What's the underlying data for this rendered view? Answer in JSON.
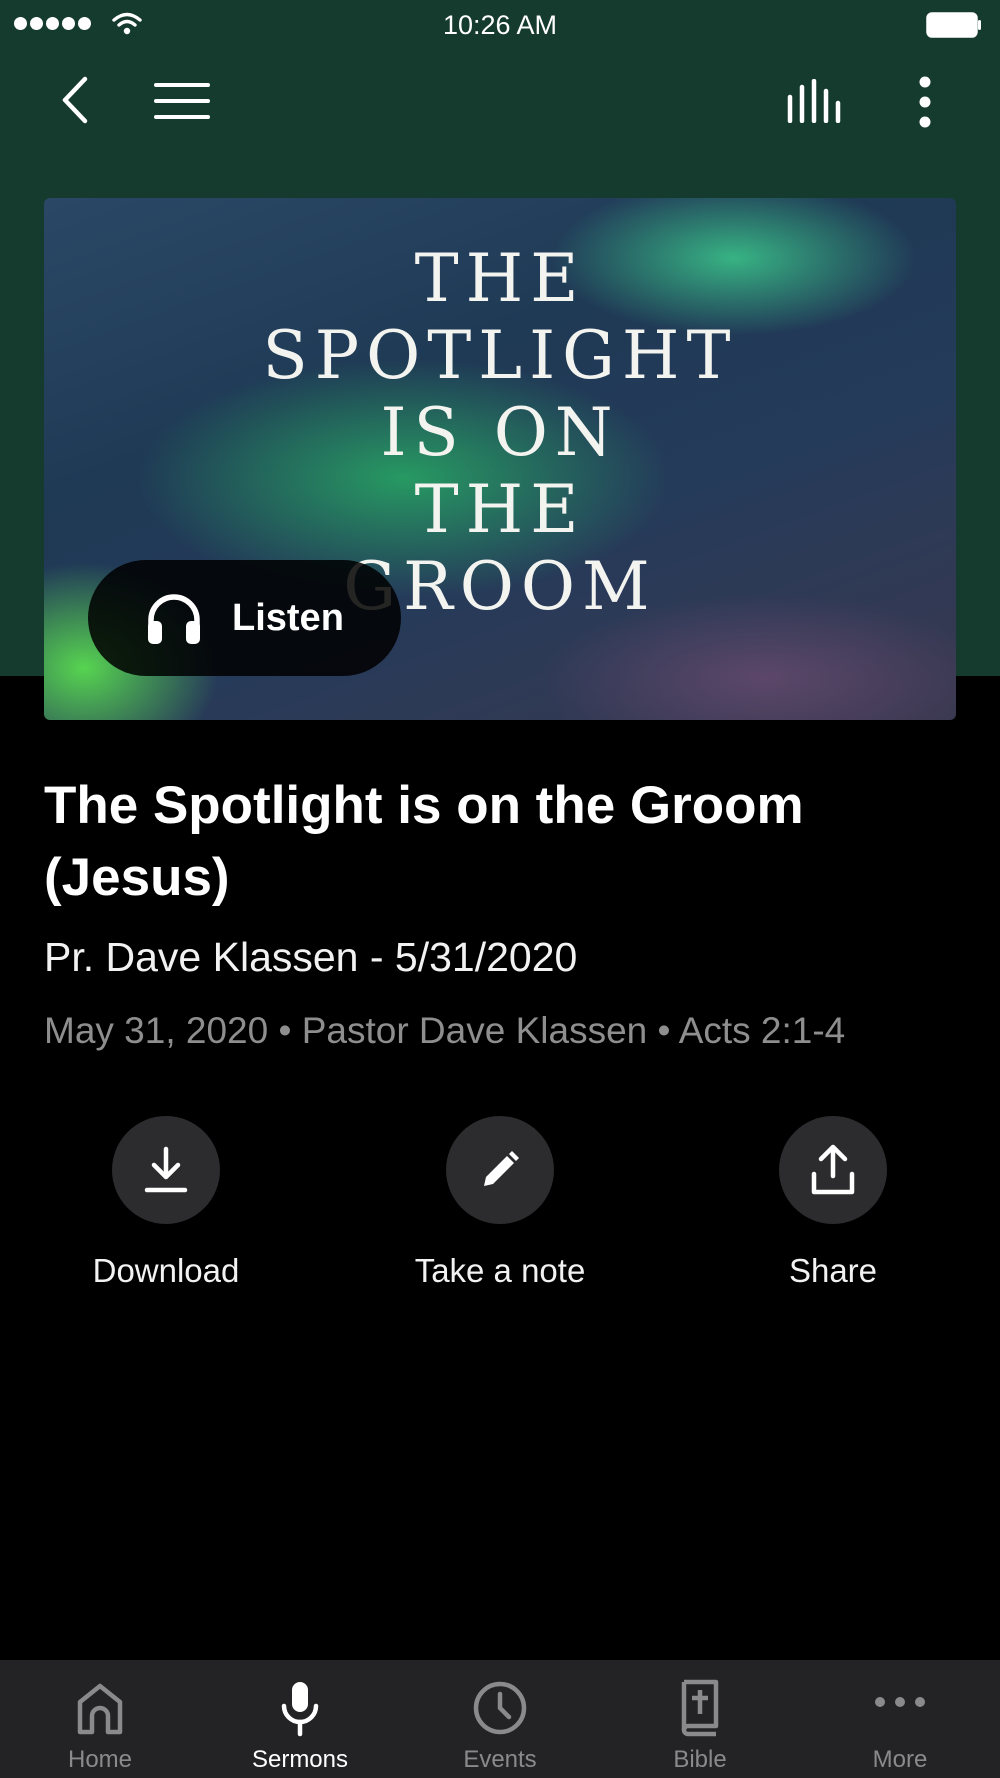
{
  "status_bar": {
    "time": "10:26 AM"
  },
  "nav": {
    "back": "back-icon",
    "menu": "menu-icon",
    "audio": "audio-bars-icon",
    "more": "more-vertical-icon"
  },
  "artwork": {
    "title": "THE\nSPOTLIGHT\nIS ON\nTHE\nGROOM"
  },
  "listen_button": {
    "label": "Listen",
    "icon": "headphones-icon"
  },
  "sermon": {
    "title": "The Spotlight is on the Groom (Jesus)",
    "subtitle": "Pr. Dave Klassen - 5/31/2020",
    "meta": "May 31, 2020 • Pastor Dave Klassen • Acts 2:1-4"
  },
  "actions": [
    {
      "label": "Download",
      "icon": "download-icon"
    },
    {
      "label": "Take a note",
      "icon": "pencil-icon"
    },
    {
      "label": "Share",
      "icon": "share-icon"
    }
  ],
  "tabs": [
    {
      "label": "Home",
      "icon": "home-icon"
    },
    {
      "label": "Sermons",
      "icon": "microphone-icon",
      "active": true
    },
    {
      "label": "Events",
      "icon": "clock-icon"
    },
    {
      "label": "Bible",
      "icon": "bible-icon"
    },
    {
      "label": "More",
      "icon": "more-horizontal-icon"
    }
  ],
  "colors": {
    "header_green": "#153a2e",
    "background": "#000000",
    "tab_bar": "#232325",
    "muted_text": "#8e8e8e"
  }
}
